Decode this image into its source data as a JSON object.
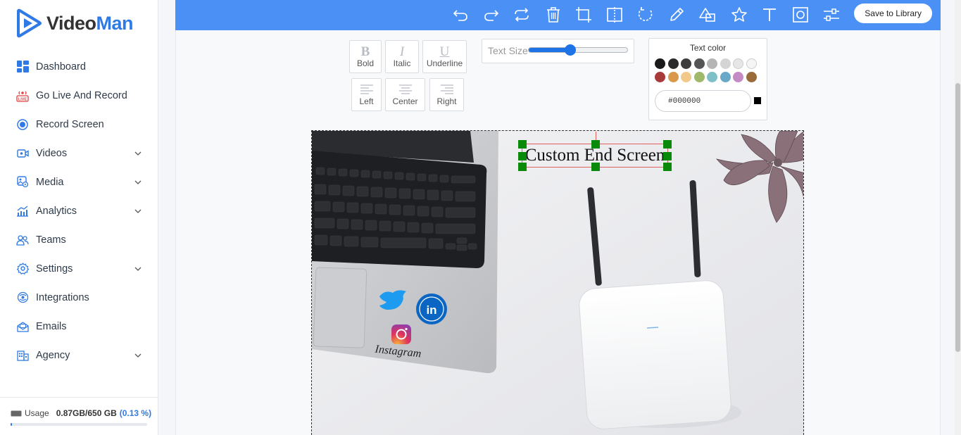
{
  "app": {
    "logo_part1": "Video",
    "logo_part2": "Man"
  },
  "nav": [
    {
      "label": "Dashboard",
      "icon": "dashboard-icon",
      "expandable": false
    },
    {
      "label": "Go Live And Record",
      "icon": "live-icon",
      "expandable": false
    },
    {
      "label": "Record Screen",
      "icon": "record-icon",
      "expandable": false
    },
    {
      "label": "Videos",
      "icon": "video-icon",
      "expandable": true
    },
    {
      "label": "Media",
      "icon": "media-icon",
      "expandable": true
    },
    {
      "label": "Analytics",
      "icon": "analytics-icon",
      "expandable": true
    },
    {
      "label": "Teams",
      "icon": "teams-icon",
      "expandable": false
    },
    {
      "label": "Settings",
      "icon": "gear-icon",
      "expandable": true
    },
    {
      "label": "Integrations",
      "icon": "integrations-icon",
      "expandable": false
    },
    {
      "label": "Emails",
      "icon": "email-icon",
      "expandable": false
    },
    {
      "label": "Agency",
      "icon": "agency-icon",
      "expandable": true
    }
  ],
  "usage": {
    "label": "Usage",
    "value": "0.87GB/650 GB",
    "percent_text": "(0.13 %)",
    "fraction": 0.0013
  },
  "toolbar": {
    "tools": [
      "undo-icon",
      "redo-icon",
      "repeat-icon",
      "delete-icon",
      "crop-icon",
      "flip-icon",
      "rotate-icon",
      "pencil-icon",
      "shapes-icon",
      "star-icon",
      "text-icon",
      "mask-icon",
      "filter-icon"
    ],
    "save_label": "Save to Library"
  },
  "format": {
    "bold": "Bold",
    "italic": "Italic",
    "underline": "Underline",
    "left": "Left",
    "center": "Center",
    "right": "Right",
    "bold_glyph": "B",
    "italic_glyph": "I",
    "underline_glyph": "U"
  },
  "text_size": {
    "label": "Text Size",
    "fraction": 0.42
  },
  "text_color": {
    "title": "Text color",
    "value": "#000000",
    "swatches_row1": [
      "#1a1a1a",
      "#2b2b2b",
      "#3d3d3d",
      "#555555",
      "#b5b5b5",
      "#d4d4d4",
      "#e6e6e6",
      "#f5f5f5"
    ],
    "swatches_row2": [
      "#a83a3a",
      "#d89a4a",
      "#f2c98a",
      "#9fb86a",
      "#7fc0c8",
      "#6aa8c8",
      "#c48ac4",
      "#9a6a3a"
    ]
  },
  "canvas": {
    "text": "Custom End Screen"
  },
  "accent_color": "#4a90f5"
}
